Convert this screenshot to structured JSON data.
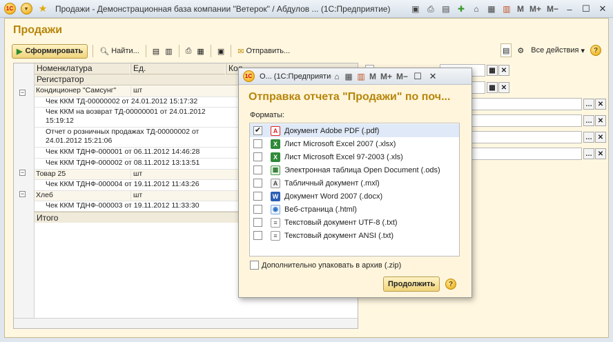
{
  "window": {
    "title": "Продажи - Демонстрационная база компании \"Ветерок\" / Абдулов ...  (1С:Предприятие)",
    "controls": {
      "m": "M",
      "mplus": "M+",
      "mminus": "M−"
    }
  },
  "page": {
    "title": "Продажи"
  },
  "toolbar": {
    "form_label": "Сформировать",
    "find_label": "Найти...",
    "send_label": "Отправить...",
    "all_actions_label": "Все действия"
  },
  "table": {
    "headers": {
      "nomenclature": "Номенклатура",
      "unit": "Ед.",
      "registrar": "Регистратор",
      "extra": "Кол"
    },
    "rows": [
      {
        "kind": "group",
        "name": "Кондиционер \"Самсунг\"",
        "unit": "шт"
      },
      {
        "kind": "doc",
        "name": "Чек ККМ ТД-00000002 от 24.01.2012 15:17:32"
      },
      {
        "kind": "doc",
        "name": "Чек ККМ на возврат ТД-00000001 от 24.01.2012 15:19:12"
      },
      {
        "kind": "doc",
        "name": "Отчет о розничных продажах ТД-00000002 от 24.01.2012 15:21:06"
      },
      {
        "kind": "doc",
        "name": "Чек ККМ ТДНФ-000001 от 06.11.2012 14:46:28"
      },
      {
        "kind": "doc",
        "name": "Чек ККМ ТДНФ-000002 от 08.11.2012 13:13:51"
      },
      {
        "kind": "group",
        "name": "Товар 25",
        "unit": "шт"
      },
      {
        "kind": "doc",
        "name": "Чек ККМ ТДНФ-000004 от 19.11.2012 11:43:26"
      },
      {
        "kind": "group",
        "name": "Хлеб",
        "unit": "шт"
      },
      {
        "kind": "doc",
        "name": "Чек ККМ ТДНФ-000003 от 19.11.2012 11:33:30"
      }
    ],
    "total_label": "Итого"
  },
  "dialog": {
    "title": "О...  (1С:Предприятие)",
    "heading": "Отправка отчета \"Продажи\" по поч...",
    "formats_label": "Форматы:",
    "formats": [
      {
        "label": "Документ Adobe PDF (.pdf)",
        "checked": true,
        "icon": "pdf-icon"
      },
      {
        "label": "Лист Microsoft Excel 2007 (.xlsx)",
        "checked": false,
        "icon": "excel-icon"
      },
      {
        "label": "Лист Microsoft Excel 97-2003 (.xls)",
        "checked": false,
        "icon": "excel-icon"
      },
      {
        "label": "Электронная таблица Open Document (.ods)",
        "checked": false,
        "icon": "ods-icon"
      },
      {
        "label": "Табличный документ (.mxl)",
        "checked": false,
        "icon": "mxl-icon"
      },
      {
        "label": "Документ Word 2007 (.docx)",
        "checked": false,
        "icon": "word-icon"
      },
      {
        "label": "Веб-страница (.html)",
        "checked": false,
        "icon": "html-icon"
      },
      {
        "label": "Текстовый документ UTF-8 (.txt)",
        "checked": false,
        "icon": "txt-icon"
      },
      {
        "label": "Текстовый документ ANSI (.txt)",
        "checked": false,
        "icon": "txt-icon"
      }
    ],
    "archive_label": "Дополнительно упаковать в архив (.zip)",
    "continue_label": "Продолжить"
  },
  "colors": {
    "accent": "#b6860a",
    "button": "#f0d47a"
  }
}
